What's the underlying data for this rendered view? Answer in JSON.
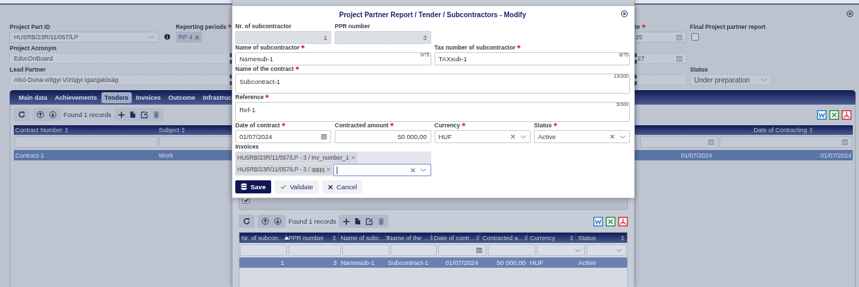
{
  "page": {
    "project_part_id": {
      "label": "Project Part ID",
      "value": "HUSRB/23R/11/057/LP"
    },
    "reporting_periods": {
      "label": "Reporting periods",
      "required": true,
      "chips": [
        "RP 4"
      ]
    },
    "date_field_a": {
      "label": "te",
      "required": true,
      "value": "25"
    },
    "final_report": {
      "label": "Final Project partner report",
      "checked": false
    },
    "project_acronym": {
      "label": "Project Acronym",
      "value": "EducOnBoard"
    },
    "date_field_b": {
      "value": "27"
    },
    "lead_partner": {
      "label": "Lead Partner",
      "value": "Alsó-Duna-völgyi Vízügyi Igazgatóság"
    },
    "status": {
      "label": "Status",
      "value": "Under preparation"
    }
  },
  "tabs": [
    {
      "label": "Main data",
      "selected": false
    },
    {
      "label": "Achievements",
      "selected": false
    },
    {
      "label": "Tenders",
      "selected": true
    },
    {
      "label": "Invoices",
      "selected": false
    },
    {
      "label": "Outcome",
      "selected": false
    },
    {
      "label": "Infrastruc",
      "selected": false
    }
  ],
  "tenders": {
    "records": "Found 1 records",
    "columns": [
      {
        "label": "Contract Number",
        "kind": "text"
      },
      {
        "label": "Subject",
        "kind": "text"
      },
      {
        "kind": "date"
      },
      {
        "label": "Date of Contracting",
        "kind": "date"
      }
    ],
    "rows": [
      {
        "selected": true,
        "cells": [
          "Contract-1",
          "Work",
          "01/07/2024",
          "01/07/2024"
        ]
      }
    ]
  },
  "subcontractors": {
    "active_only": {
      "checked": true
    },
    "records": "Found 1 records",
    "columns": [
      {
        "label": "Nr. of subcon…",
        "sorted": true,
        "kind": "text"
      },
      {
        "label": "PPR number",
        "sorted": false,
        "kind": "text"
      },
      {
        "label": "Name of subc…",
        "sorted": false,
        "kind": "text"
      },
      {
        "label": "Name of the …",
        "sorted": false,
        "kind": "text"
      },
      {
        "label": "Date of contr…",
        "sorted": false,
        "kind": "date"
      },
      {
        "label": "Contracted a…",
        "sorted": false,
        "kind": "text"
      },
      {
        "label": "Currency",
        "sorted": false,
        "kind": "select"
      },
      {
        "label": "Status",
        "sorted": false,
        "kind": "select"
      }
    ],
    "rows": [
      {
        "selected": true,
        "cells": [
          "1",
          "3",
          "Namesub-1",
          "Subcontract-1",
          "01/07/2024",
          "50 000,00",
          "HUF",
          "Active"
        ]
      }
    ]
  },
  "modal": {
    "title": "Project Partner Report / Tender / Subcontractors - Modify",
    "nr_of_subcontractor": {
      "label": "Nr. of subcontractor",
      "value": "1"
    },
    "ppr_number": {
      "label": "PPR number",
      "value": "3"
    },
    "name_of_subcontractor": {
      "label": "Name of subcontractor",
      "required": true,
      "value": "Namesub-1",
      "counter": "9/75"
    },
    "tax_number": {
      "label": "Tax number of subcontractor",
      "required": true,
      "value": "TAXsub-1",
      "counter": "8/75"
    },
    "name_of_contract": {
      "label": "Name of the contract",
      "required": true,
      "value": "Subcontract-1",
      "counter": "13/300"
    },
    "reference": {
      "label": "Reference",
      "required": true,
      "value": "Ref-1",
      "counter": "5/300"
    },
    "date_of_contract": {
      "label": "Date of contract",
      "required": true,
      "value": "01/07/2024"
    },
    "contracted_amount": {
      "label": "Contracted amount",
      "required": true,
      "value": "50 000,00"
    },
    "currency": {
      "label": "Currency",
      "required": true,
      "value": "HUF"
    },
    "status": {
      "label": "Status",
      "required": true,
      "value": "Active"
    },
    "invoices": {
      "label": "Invoices",
      "focused": true,
      "chips": [
        "HUSRB/23R/11/057/LP - 3 / Inv_number_1",
        "HUSRB/23R/11/057/LP - 3 / qqqq"
      ]
    },
    "buttons": [
      {
        "label": "Save",
        "kind": "save"
      },
      {
        "label": "Validate",
        "kind": "validate"
      },
      {
        "label": "Cancel",
        "kind": "cancel"
      }
    ]
  }
}
